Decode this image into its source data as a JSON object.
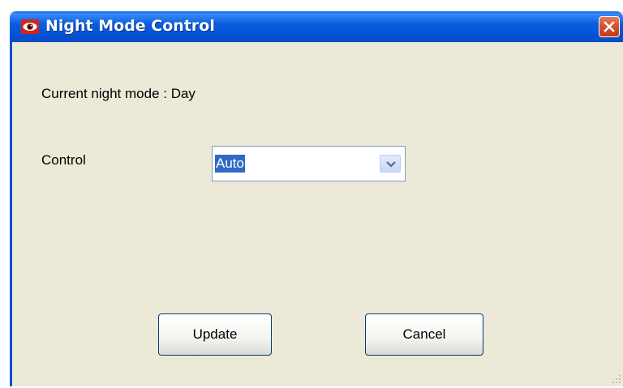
{
  "window": {
    "title": "Night Mode Control",
    "icon": "eye-icon",
    "close_icon": "close-icon"
  },
  "status": {
    "current_mode_text": "Current night mode : Day"
  },
  "control": {
    "label": "Control",
    "selected_value": "Auto"
  },
  "buttons": {
    "update_label": "Update",
    "cancel_label": "Cancel"
  },
  "colors": {
    "titlebar": "#0a5fe0",
    "dialog_background": "#ece9d8",
    "close_button": "#d8502f",
    "selection_highlight": "#316ac5"
  }
}
